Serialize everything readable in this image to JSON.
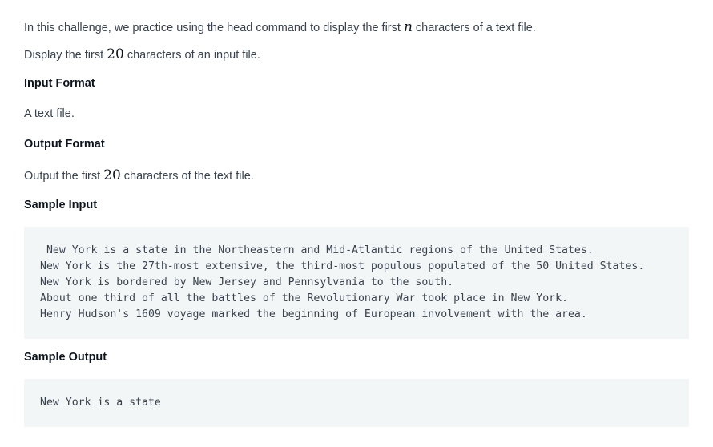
{
  "intro": {
    "before": "In this challenge, we practice using the head command to display the first ",
    "var": "n",
    "after": " characters of a text file."
  },
  "task": {
    "before": "Display the first ",
    "num": "20",
    "after": " characters of an input file."
  },
  "input_format": {
    "heading": "Input Format",
    "text": "A text file."
  },
  "output_format": {
    "heading": "Output Format",
    "before": "Output the first ",
    "num": "20",
    "after": " characters of the text file."
  },
  "sample_input": {
    "heading": "Sample Input",
    "lines": [
      " New York is a state in the Northeastern and Mid-Atlantic regions of the United States.",
      "New York is the 27th-most extensive, the third-most populous populated of the 50 United States.",
      "New York is bordered by New Jersey and Pennsylvania to the south.",
      "About one third of all the battles of the Revolutionary War took place in New York.",
      "Henry Hudson's 1609 voyage marked the beginning of European involvement with the area."
    ]
  },
  "sample_output": {
    "heading": "Sample Output",
    "lines": [
      "New York is a state"
    ]
  }
}
